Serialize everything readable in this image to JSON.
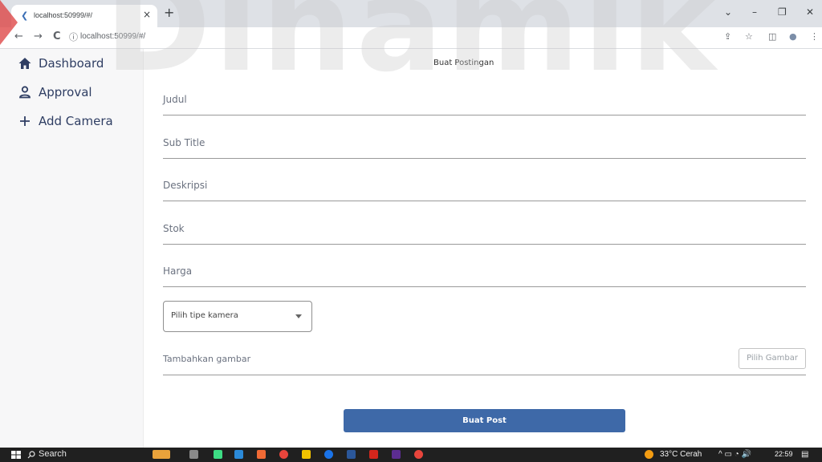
{
  "browser": {
    "tab_title": "localhost:50999/#/",
    "tab_close": "×",
    "new_tab": "+",
    "url": "localhost:50999/#/",
    "nav_back": "←",
    "nav_forward": "→",
    "nav_reload": "C",
    "info_icon": "ⓘ",
    "window_controls": {
      "chevron": "⌄",
      "minimize": "–",
      "restore": "❐",
      "close": "✕"
    },
    "right_icons": {
      "share": "⇪",
      "star": "☆",
      "sidebar": "◫",
      "profile": "●",
      "menu": "⋮"
    }
  },
  "watermark": {
    "text": "Dinamik"
  },
  "sidebar": {
    "items": [
      {
        "label": "Dashboard",
        "icon": "home-icon"
      },
      {
        "label": "Approval",
        "icon": "user-icon"
      },
      {
        "label": "Add Camera",
        "icon": "plus-icon"
      }
    ]
  },
  "form": {
    "title": "Buat Postingan",
    "fields": [
      {
        "label": "Judul"
      },
      {
        "label": "Sub Title"
      },
      {
        "label": "Deskripsi"
      },
      {
        "label": "Stok"
      },
      {
        "label": "Harga"
      }
    ],
    "camera_select": {
      "label": "Pilih tipe kamera"
    },
    "image": {
      "label": "Tambahkan gambar",
      "button": "Pilih Gambar"
    },
    "submit": "Buat Post"
  },
  "taskbar": {
    "search": "Search",
    "weather": "33°C  Cerah",
    "tray_icons": "^  ▭  ◔  🔊",
    "time": "22:59"
  },
  "colors": {
    "accent": "#3e69a8",
    "sidebar_text": "#2f3e63",
    "sidebar_bg": "#f7f7f8",
    "taskbar_bg": "#202020"
  }
}
